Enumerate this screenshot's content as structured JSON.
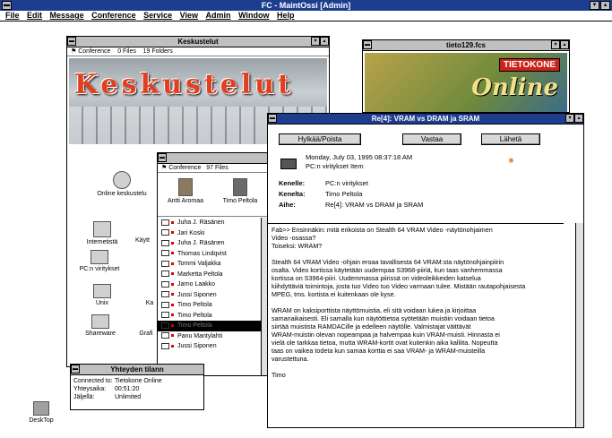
{
  "app": {
    "title": "FC - MaintOssi [Admin]",
    "menu": [
      "File",
      "Edit",
      "Message",
      "Conference",
      "Service",
      "View",
      "Admin",
      "Window",
      "Help"
    ]
  },
  "colors": {
    "titlebar": "#1d3e8f",
    "chrome": "#c0c0c0"
  },
  "keskustelut": {
    "title": "Keskustelut",
    "toolbar": {
      "label": "Conference",
      "files": "0 Files",
      "folders": "19 Folders"
    },
    "banner": "Keskustelut",
    "icons": [
      {
        "label": "Online keskustelu",
        "icon": "online-chat-icon"
      },
      {
        "label": "Internetistä",
        "icon": "internet-icon"
      },
      {
        "label": "Käytt",
        "icon": "users-icon"
      },
      {
        "label": "PC:n viritykset",
        "icon": "pc-icon"
      },
      {
        "label": "Unix",
        "icon": "unix-icon"
      },
      {
        "label": "Ka",
        "icon": "folder-icon"
      },
      {
        "label": "Shareware",
        "icon": "shareware-icon"
      },
      {
        "label": "Grafi",
        "icon": "graphics-icon"
      }
    ]
  },
  "tieto": {
    "title": "tieto129.fcs",
    "logo_top": "TIETOKONE",
    "logo_main": "Online"
  },
  "conference_list": {
    "toolbar": {
      "label": "Conference",
      "files": "97 Files"
    },
    "users": [
      "Antti Aromaa",
      "Timo Peltola"
    ],
    "rows": [
      "Juha J. Räsänen",
      "Jari Koski",
      "Juha J. Räsänen",
      "Thomas Lindqvist",
      "Tommi Valjakka",
      "Marketta Peltola",
      "Jarno Laakko",
      "Jussi Siponen",
      "Timo Peltola",
      "Timo Peltola",
      "Timo Peltola",
      "Panu Mantylahti",
      "Jussi Siponen"
    ],
    "selected_index": 10
  },
  "message": {
    "title": "Re[4]: VRAM vs DRAM ja SRAM",
    "buttons": {
      "reject": "Hylkää/Poista",
      "reply": "Vastaa",
      "send": "Lähetä"
    },
    "date": "Monday, July 03, 1995 08:37:18 AM",
    "item": "PC:n viritykset Item",
    "fields": [
      {
        "label": "Kenelle:",
        "value": "PC:n viritykset"
      },
      {
        "label": "Kenelta:",
        "value": "Timo Peltola"
      },
      {
        "label": "Aihe:",
        "value": "Re[4]: VRAM vs DRAM ja SRAM"
      }
    ],
    "body": "Fab>> Ensinnäkin: mitä erikoista on Stealth 64 VRAM Video -näytönohjaimen\nVideo -osassa?\nToiseksi: WRAM?\n\nStealth 64 VRAM Video -ohjain eroaa tavallisesta 64 VRAM:sta näytönohjainpiirin\nosalta. Video kortissa käytetään uudempaa S3968-piiriä, kun taas vanhemmassa\nkortissa on S3964-piiri. Uudemmassa piirissä on videoleikkeiden katselua\nkiihdyttäviä toimintoja, josta tuo Video tuo Video varmaan tulee. Mistään rautapohjaisesta\nMPEG, tms. kortista ei kuitenkaan ole kyse.\n\nWRAM on kaksiporttista näyttömuistia, eli sitä voidaan lukea ja kirjoittaa\nsamanaikaisesti. Eli samalla kun näytöttietoa syötetään muistiin voidaan tietoa\nsiirtää muistista RAMDACille ja edelleen näytölle. Valmistajat väittävät\nWRAM-muistin olevan nopeampaa ja halvempaa kuin VRAM-muisti. Hinnasta ei\nvielä ole tarkkaa tietoa, mutta WRAM-kortit ovat kuitenkin aika kalliita. Nopeutta\ntaas on vaikea todeta kun samaa korttia ei saa VRAM- ja WRAM-muisteilla\nvarustettuna.\n\nTimo"
  },
  "status": {
    "title": "Yhteyden tilann",
    "lines": [
      {
        "label": "Connected to:",
        "value": "Tietokone Online"
      },
      {
        "label": "Yhteysaika:",
        "value": "00:51:20"
      },
      {
        "label": "Jäljellä:",
        "value": "Unlimited"
      }
    ]
  },
  "desktop_icon": {
    "label": "DeskTop"
  }
}
